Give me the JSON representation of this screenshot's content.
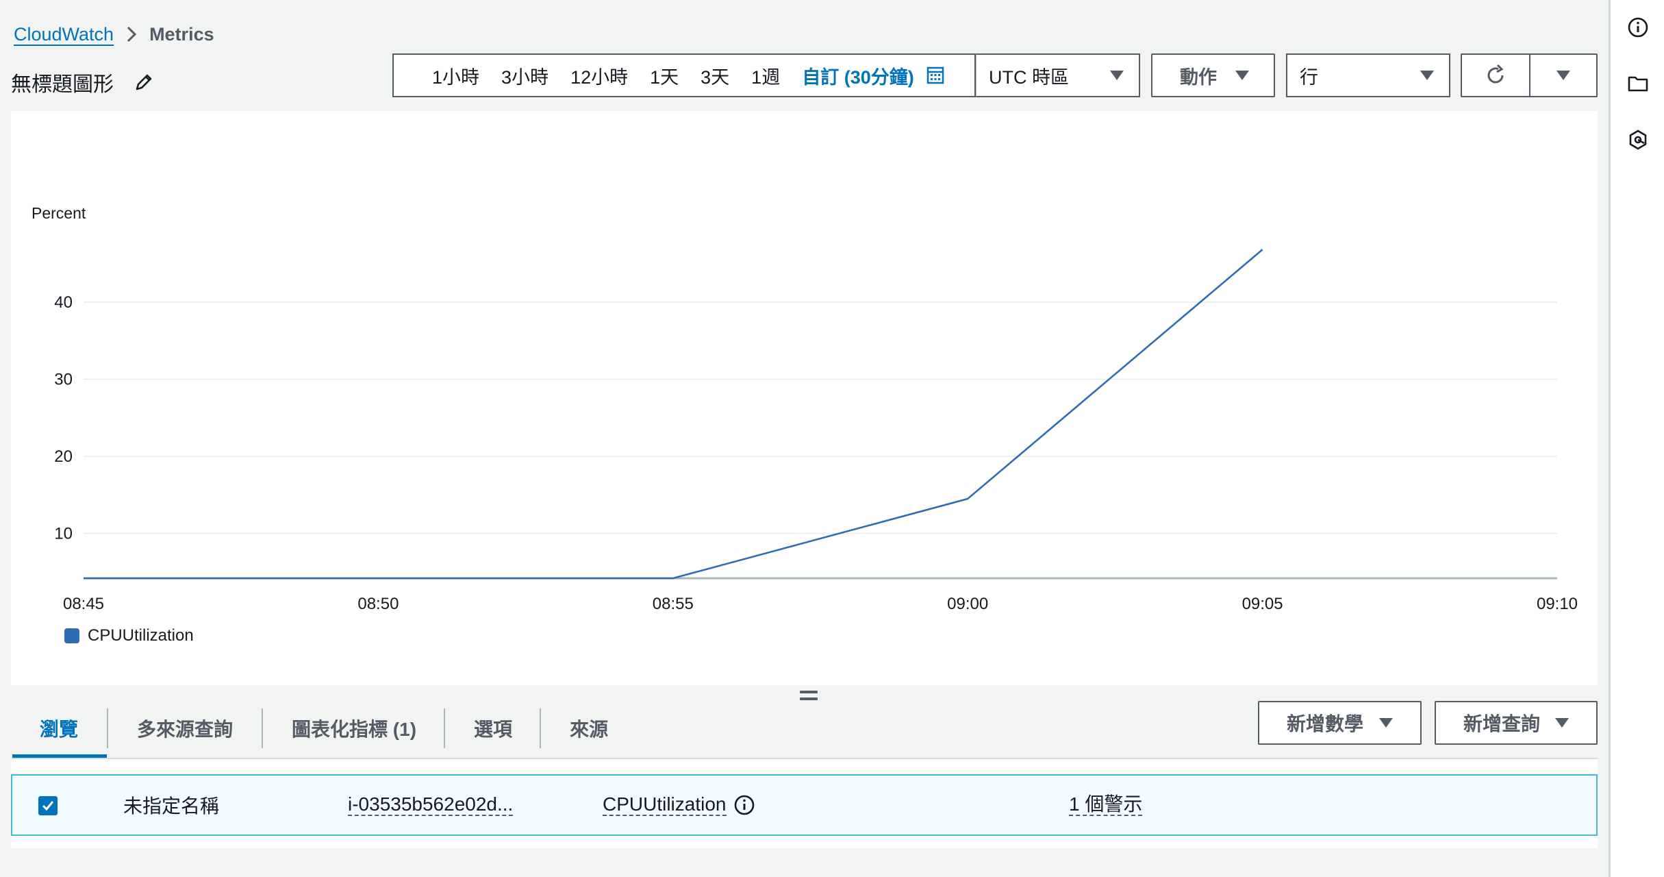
{
  "breadcrumb": {
    "root": "CloudWatch",
    "current": "Metrics"
  },
  "graph": {
    "title": "無標題圖形"
  },
  "toolbar": {
    "ranges": [
      "1小時",
      "3小時",
      "12小時",
      "1天",
      "3天",
      "1週"
    ],
    "custom_range": "自訂 (30分鐘)",
    "timezone": "UTC 時區",
    "actions_label": "動作",
    "view_type": "行"
  },
  "chart_data": {
    "type": "line",
    "ylabel": "Percent",
    "y_ticks": [
      10,
      20,
      30,
      40
    ],
    "ylim": [
      4.2,
      47
    ],
    "x_ticks": [
      "08:45",
      "08:50",
      "08:55",
      "09:00",
      "09:05",
      "09:10"
    ],
    "series": [
      {
        "name": "CPUUtilization",
        "x": [
          "08:45",
          "08:55",
          "09:00",
          "09:05"
        ],
        "values": [
          4.2,
          4.2,
          14.5,
          46.8
        ],
        "color": "#2e6db3"
      }
    ],
    "grid": true,
    "legend": "bottom-left"
  },
  "tabs": [
    "瀏覽",
    "多來源查詢",
    "圖表化指標 (1)",
    "選項",
    "來源"
  ],
  "buttons": {
    "add_math": "新增數學",
    "add_query": "新增查詢"
  },
  "metrics_table": {
    "rows": [
      {
        "checked": true,
        "label": "未指定名稱",
        "instance": "i-03535b562e02d...",
        "metric": "CPUUtilization",
        "alarms": "1 個警示"
      }
    ]
  },
  "colors": {
    "accent": "#0073bb",
    "line": "#2e6db3",
    "row_highlight": "#f1faff",
    "row_border": "#44b9d6"
  }
}
